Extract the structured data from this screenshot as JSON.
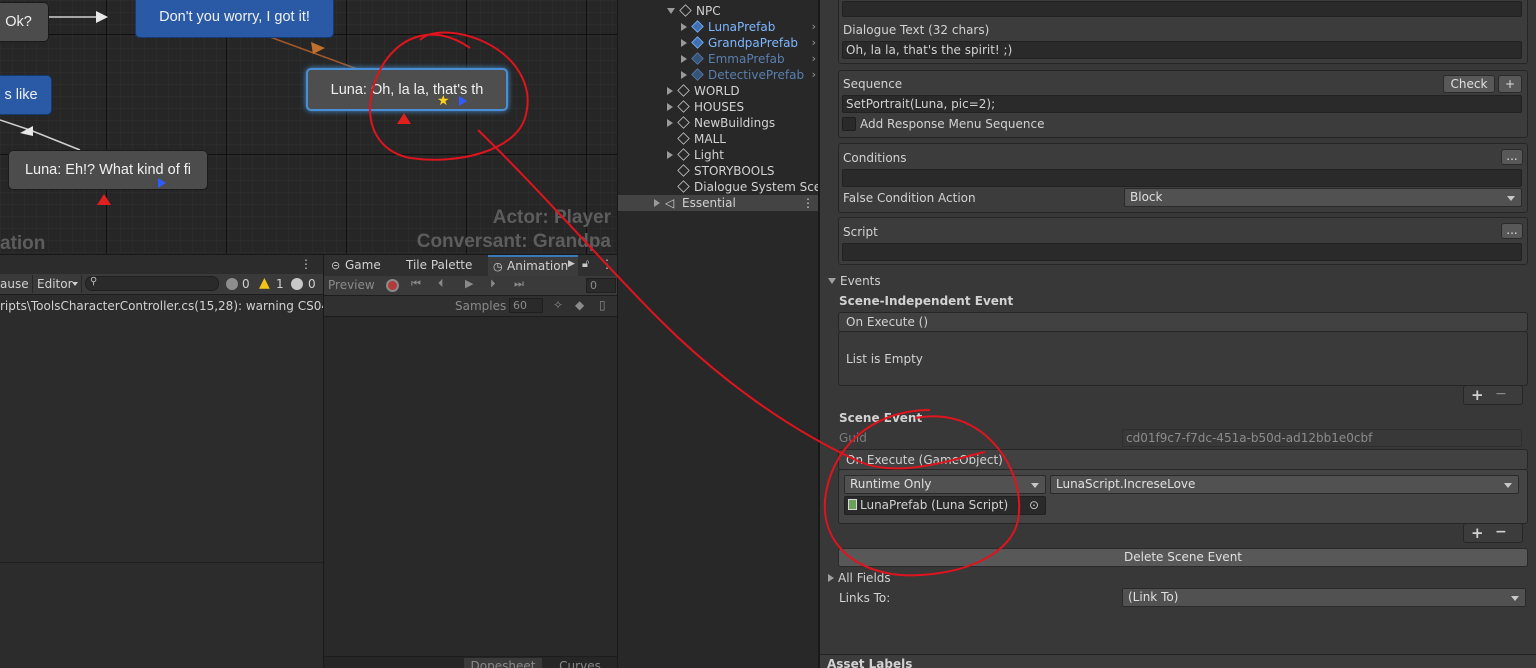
{
  "graph": {
    "nodes": {
      "ok": "Ok?",
      "got_it": "Don't you worry, I got it!",
      "like": "s like",
      "luna_oh": "Luna: Oh, la la, that's th",
      "luna_eh": "Luna: Eh!? What kind of fi"
    },
    "actor": "Actor: Player",
    "conversant": "Conversant: Grandpa",
    "title_fragment": "ation"
  },
  "console": {
    "pause": "ause",
    "editor": "Editor",
    "counts": {
      "info": "0",
      "warn": "1",
      "error": "0"
    },
    "message": "ripts\\ToolsCharacterController.cs(15,28): warning CS0414"
  },
  "animation_panel": {
    "tabs": [
      "Game",
      "Tile Palette",
      "Animation"
    ],
    "preview": "Preview",
    "frame": "0",
    "samples_label": "Samples",
    "samples_value": "60",
    "bottom_tabs": [
      "Dopesheet",
      "Curves"
    ]
  },
  "hierarchy": {
    "items": [
      {
        "label": "NPC",
        "kind": "folder",
        "fold": "open",
        "indent": 0
      },
      {
        "label": "LunaPrefab",
        "kind": "prefab",
        "fold": "closed",
        "indent": 1
      },
      {
        "label": "GrandpaPrefab",
        "kind": "prefab",
        "fold": "closed",
        "indent": 1
      },
      {
        "label": "EmmaPrefab",
        "kind": "prefab-dim",
        "fold": "closed",
        "indent": 1
      },
      {
        "label": "DetectivePrefab",
        "kind": "prefab-dim",
        "fold": "closed",
        "indent": 1
      },
      {
        "label": "WORLD",
        "kind": "folder",
        "fold": "closed",
        "indent": 0
      },
      {
        "label": "HOUSES",
        "kind": "folder",
        "fold": "closed",
        "indent": 0
      },
      {
        "label": "NewBuildings",
        "kind": "folder",
        "fold": "closed",
        "indent": 0
      },
      {
        "label": "MALL",
        "kind": "folder",
        "fold": "none",
        "indent": 0
      },
      {
        "label": "Light",
        "kind": "folder",
        "fold": "closed",
        "indent": 0
      },
      {
        "label": "STORYBOOLS",
        "kind": "folder",
        "fold": "none",
        "indent": 0
      },
      {
        "label": "Dialogue System Sce",
        "kind": "folder",
        "fold": "none",
        "indent": 0
      }
    ],
    "scene_label": "Essential"
  },
  "inspector": {
    "dialogue_text_label": "Dialogue Text (32 chars)",
    "dialogue_text_value": "Oh, la la, that's the spirit! ;)",
    "sequence_label": "Sequence",
    "check_button": "Check",
    "plus": "+",
    "minus": "−",
    "sequence_value": "SetPortrait(Luna, pic=2);",
    "add_response": "Add Response Menu Sequence",
    "conditions_label": "Conditions",
    "ellipsis": "...",
    "false_condition_label": "False Condition Action",
    "false_condition_value": "Block",
    "script_label": "Script",
    "events_label": "Events",
    "scene_independent_label": "Scene-Independent Event",
    "on_execute_label": "On Execute ()",
    "list_empty": "List is Empty",
    "scene_event_label": "Scene Event",
    "guid_label": "Guid",
    "guid_value": "cd01f9c7-f7dc-451a-b50d-ad12bb1e0cbf",
    "on_execute_go_label": "On Execute (GameObject)",
    "runtime_value": "Runtime Only",
    "function_value": "LunaScript.IncreseLove",
    "object_value": "LunaPrefab (Luna Script)",
    "delete_scene_event": "Delete Scene Event",
    "all_fields": "All Fields",
    "links_to_label": "Links To:",
    "links_to_value": "(Link To)",
    "asset_labels": "Asset Labels"
  },
  "colors": {
    "annotation": "#e0141e",
    "selection": "#4a8fd6",
    "prefab": "#7eb6ff"
  }
}
